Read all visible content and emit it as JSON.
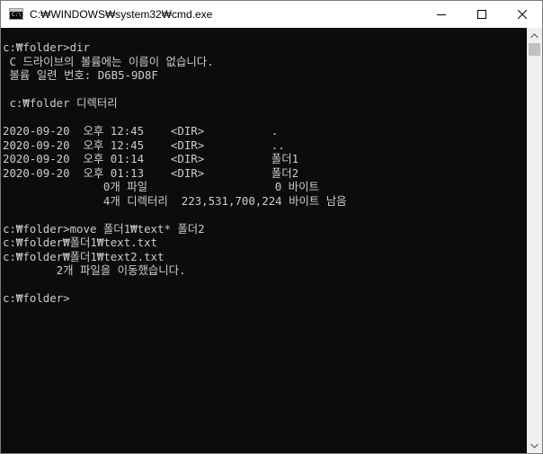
{
  "window": {
    "title": "C:₩WINDOWS₩system32₩cmd.exe",
    "icon": "cmd-icon",
    "icon_glyph": "C:\\_"
  },
  "controls": {
    "minimize_icon": "minimize-icon",
    "maximize_icon": "maximize-icon",
    "close_icon": "close-icon"
  },
  "console": {
    "background": "#0c0c0c",
    "foreground": "#cccccc",
    "lines": [
      "c:₩folder>dir",
      " C 드라이브의 볼륨에는 이름이 없습니다.",
      " 볼륨 일련 번호: D6B5-9D8F",
      "",
      " c:₩folder 디렉터리",
      "",
      "2020-09-20  오후 12:45    <DIR>          .",
      "2020-09-20  오후 12:45    <DIR>          ..",
      "2020-09-20  오후 01:14    <DIR>          폴더1",
      "2020-09-20  오후 01:13    <DIR>          폴더2",
      "               0개 파일                   0 바이트",
      "               4개 디렉터리  223,531,700,224 바이트 남음",
      "",
      "c:₩folder>move 폴더1₩text* 폴더2",
      "c:₩folder₩폴더1₩text.txt",
      "c:₩folder₩폴더1₩text2.txt",
      "        2개 파일을 이동했습니다.",
      "",
      "c:₩folder>"
    ]
  },
  "scrollbar": {
    "up_icon": "scroll-up-arrow-icon",
    "down_icon": "scroll-down-arrow-icon"
  }
}
